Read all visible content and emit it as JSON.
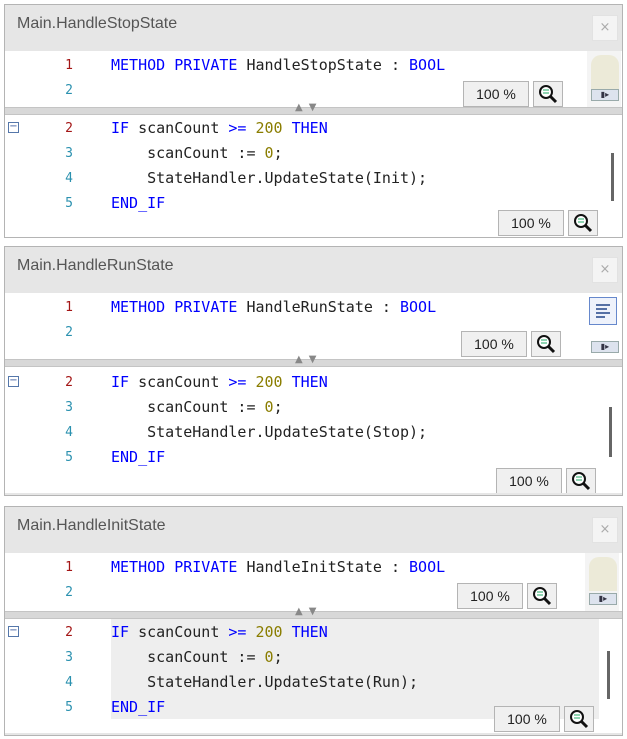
{
  "windows": [
    {
      "title": "Main.HandleStopState",
      "close_symbol": "×",
      "decl": {
        "line_no": [
          "1",
          "2"
        ],
        "code": "HandleStopState"
      },
      "impl": {
        "line_no": [
          "2",
          "3",
          "4",
          "5"
        ],
        "update_arg": "Init"
      },
      "zoom_top": "100 %",
      "zoom_bottom": "100 %",
      "scroll_tab": "▮▸"
    },
    {
      "title": "Main.HandleRunState",
      "close_symbol": "×",
      "decl": {
        "line_no": [
          "1",
          "2"
        ],
        "code": "HandleRunState"
      },
      "impl": {
        "line_no": [
          "2",
          "3",
          "4",
          "5"
        ],
        "update_arg": "Stop"
      },
      "zoom_top": "100 %",
      "zoom_bottom": "100 %",
      "scroll_tab": "▮▸"
    },
    {
      "title": "Main.HandleInitState",
      "close_symbol": "×",
      "decl": {
        "line_no": [
          "1",
          "2"
        ],
        "code": "HandleInitState"
      },
      "impl": {
        "line_no": [
          "2",
          "3",
          "4",
          "5"
        ],
        "update_arg": "Run"
      },
      "zoom_top": "100 %",
      "zoom_bottom": "100 %",
      "scroll_tab": "▮▸"
    }
  ],
  "code_text": {
    "method_kw": "METHOD",
    "private_kw": "PRIVATE",
    "colon": " : ",
    "bool_kw": "BOOL",
    "if_kw": "IF",
    "scancount": " scanCount ",
    "gte": ">=",
    "two_hundred": " 200",
    "then_kw": " THEN",
    "reset": "    scanCount := ",
    "zero": "0",
    "semicolon": ";",
    "update_prefix": "    StateHandler.UpdateState(",
    "update_suffix": ");",
    "endif_kw": "END_IF"
  },
  "colors": {
    "keyword": "#0000ff",
    "number": "#8a7d00",
    "line_number": "#2b91af",
    "line_number_changed": "#a31515"
  }
}
